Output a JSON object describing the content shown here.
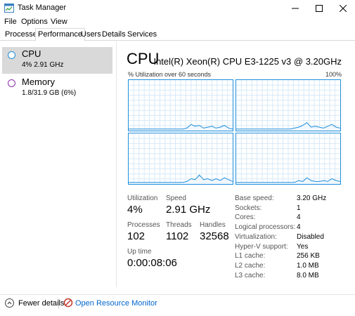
{
  "window": {
    "title": "Task Manager"
  },
  "menu": [
    "File",
    "Options",
    "View"
  ],
  "tabs": [
    "Processes",
    "Performance",
    "Users",
    "Details",
    "Services"
  ],
  "sidebar": {
    "items": [
      {
        "name": "CPU",
        "sub": "4% 2.91 GHz",
        "color": "#1f8fdc",
        "selected": true
      },
      {
        "name": "Memory",
        "sub": "1.8/31.9 GB (6%)",
        "color": "#8b2fa8",
        "selected": false
      }
    ]
  },
  "main": {
    "title": "CPU",
    "model": "Intel(R) Xeon(R) CPU E3-1225 v3 @ 3.20GHz",
    "util_caption": "% Utilization over 60 seconds",
    "max_pct": "100%",
    "graph_color": "#1f8fdc",
    "stats": {
      "utilization_label": "Utilization",
      "utilization": "4%",
      "speed_label": "Speed",
      "speed": "2.91 GHz",
      "processes_label": "Processes",
      "processes": "102",
      "threads_label": "Threads",
      "threads": "1102",
      "handles_label": "Handles",
      "handles": "32568",
      "uptime_label": "Up time",
      "uptime": "0:00:08:06"
    },
    "specs": [
      {
        "label": "Base speed:",
        "value": "3.20 GHz"
      },
      {
        "label": "Sockets:",
        "value": "1"
      },
      {
        "label": "Cores:",
        "value": "4"
      },
      {
        "label": "Logical processors:",
        "value": "4"
      },
      {
        "label": "Virtualization:",
        "value": "Disabled"
      },
      {
        "label": "Hyper-V support:",
        "value": "Yes"
      },
      {
        "label": "L1 cache:",
        "value": "256 KB"
      },
      {
        "label": "L2 cache:",
        "value": "1.0 MB"
      },
      {
        "label": "L3 cache:",
        "value": "8.0 MB"
      }
    ]
  },
  "footer": {
    "fewer_details": "Fewer details",
    "open_resource_monitor": "Open Resource Monitor"
  }
}
